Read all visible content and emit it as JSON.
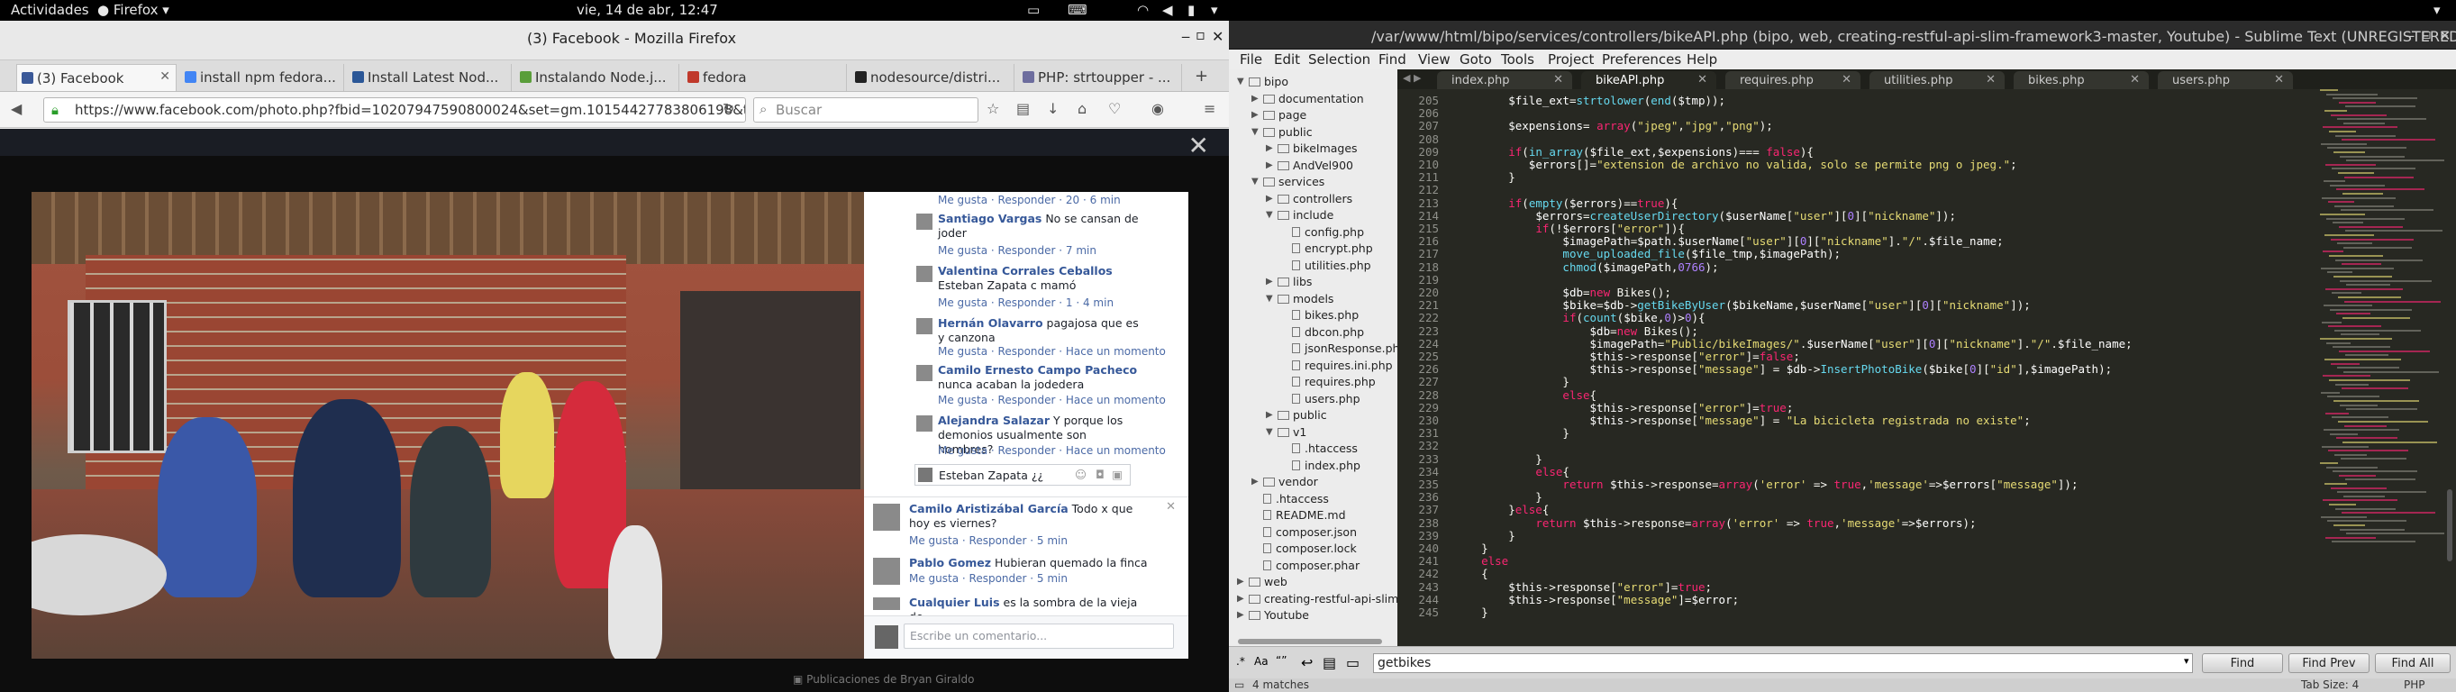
{
  "topbar": {
    "activities": "Actividades",
    "app": "Firefox",
    "clock": "vie, 14 de abr, 12:47"
  },
  "firefox": {
    "title": "(3) Facebook - Mozilla Firefox",
    "tabs": [
      {
        "label": "(3) Facebook",
        "color": "#3b5998"
      },
      {
        "label": "install npm fedora...",
        "color": "#4285f4"
      },
      {
        "label": "Install Latest Nod...",
        "color": "#2b5797"
      },
      {
        "label": "Instalando Node.j...",
        "color": "#5a9e3a"
      },
      {
        "label": "fedora",
        "color": "#c0392b"
      },
      {
        "label": "nodesource/distri...",
        "color": "#222222"
      },
      {
        "label": "PHP: strtoupper - ...",
        "color": "#6d6d9e"
      }
    ],
    "url": "https://www.facebook.com/photo.php?fbid=10207947590800024&set=gm.1015442778380​6198&type=3&",
    "search_placeholder": "Buscar"
  },
  "facebook": {
    "comments": [
      {
        "name": "",
        "text": "",
        "meta": "Me gusta · Responder · 20 · 6 min"
      },
      {
        "name": "Santiago Vargas",
        "text": "No se cansan de joder",
        "meta": "Me gusta · Responder · 7 min"
      },
      {
        "name": "Valentina Corrales Ceballos",
        "text": "Esteban Zapata c mamó",
        "meta": "Me gusta · Responder · 1 · 4 min"
      },
      {
        "name": "Hernán Olavarro",
        "text": "pagajosa que es y canzona",
        "meta": "Me gusta · Responder · Hace un momento"
      },
      {
        "name": "Camilo Ernesto Campo Pacheco",
        "text": "nunca acaban la jodedera",
        "meta": "Me gusta · Responder · Hace un momento"
      },
      {
        "name": "Alejandra Salazar",
        "text": "Y porque los demonios usualmente son hombres?",
        "meta": "Me gusta · Responder · Hace un momento"
      }
    ],
    "reply_input": "Esteban Zapata ¿¿",
    "comments2": [
      {
        "name": "Camilo Aristizábal García",
        "text": "Todo x que hoy es viernes?",
        "meta": "Me gusta · Responder · 5 min"
      },
      {
        "name": "Pablo Gomez",
        "text": "Hubieran quemado la finca",
        "meta": "Me gusta · Responder · 5 min"
      },
      {
        "name": "Cualquier Luis",
        "text": "es la sombra de la vieja de",
        "meta": ""
      }
    ],
    "comment_placeholder": "Escribe un comentario...",
    "bg_label": "Publicaciones de Bryan Giraldo"
  },
  "sublime": {
    "title": "/var/www/html/bipo/services/controllers/bikeAPI.php (bipo, web, creating-restful-api-slim-framework3-master, Youtube) - Sublime Text (UNREGISTERED)",
    "menu": [
      "File",
      "Edit",
      "Selection",
      "Find",
      "View",
      "Goto",
      "Tools",
      "Project",
      "Preferences",
      "Help"
    ],
    "tabs": [
      "index.php",
      "bikeAPI.php",
      "requires.php",
      "utilities.php",
      "bikes.php",
      "users.php"
    ],
    "active_tab": 1,
    "tree": [
      {
        "d": 0,
        "t": "folder",
        "open": true,
        "label": "bipo"
      },
      {
        "d": 1,
        "t": "folder",
        "open": false,
        "label": "documentation"
      },
      {
        "d": 1,
        "t": "folder",
        "open": false,
        "label": "page"
      },
      {
        "d": 1,
        "t": "folder",
        "open": true,
        "label": "public"
      },
      {
        "d": 2,
        "t": "folder",
        "open": false,
        "label": "bikeImages"
      },
      {
        "d": 2,
        "t": "folder",
        "open": false,
        "label": "AndVel900"
      },
      {
        "d": 1,
        "t": "folder",
        "open": true,
        "label": "services"
      },
      {
        "d": 2,
        "t": "folder",
        "open": false,
        "label": "controllers"
      },
      {
        "d": 2,
        "t": "folder",
        "open": true,
        "label": "include"
      },
      {
        "d": 3,
        "t": "file",
        "label": "config.php"
      },
      {
        "d": 3,
        "t": "file",
        "label": "encrypt.php"
      },
      {
        "d": 3,
        "t": "file",
        "label": "utilities.php"
      },
      {
        "d": 2,
        "t": "folder",
        "open": false,
        "label": "libs"
      },
      {
        "d": 2,
        "t": "folder",
        "open": true,
        "label": "models"
      },
      {
        "d": 3,
        "t": "file",
        "label": "bikes.php"
      },
      {
        "d": 3,
        "t": "file",
        "label": "dbcon.php"
      },
      {
        "d": 3,
        "t": "file",
        "label": "jsonResponse.php"
      },
      {
        "d": 3,
        "t": "file",
        "label": "requires.ini.php"
      },
      {
        "d": 3,
        "t": "file",
        "label": "requires.php"
      },
      {
        "d": 3,
        "t": "file",
        "label": "users.php"
      },
      {
        "d": 2,
        "t": "folder",
        "open": false,
        "label": "public"
      },
      {
        "d": 2,
        "t": "folder",
        "open": true,
        "label": "v1"
      },
      {
        "d": 3,
        "t": "file",
        "label": ".htaccess"
      },
      {
        "d": 3,
        "t": "file",
        "label": "index.php"
      },
      {
        "d": 1,
        "t": "folder",
        "open": false,
        "label": "vendor"
      },
      {
        "d": 1,
        "t": "file",
        "label": ".htaccess"
      },
      {
        "d": 1,
        "t": "file",
        "label": "README.md"
      },
      {
        "d": 1,
        "t": "file",
        "label": "composer.json"
      },
      {
        "d": 1,
        "t": "file",
        "label": "composer.lock"
      },
      {
        "d": 1,
        "t": "file",
        "label": "composer.phar"
      },
      {
        "d": 0,
        "t": "folder",
        "open": false,
        "label": "web"
      },
      {
        "d": 0,
        "t": "folder",
        "open": false,
        "label": "creating-restful-api-slim-fr"
      },
      {
        "d": 0,
        "t": "folder",
        "open": false,
        "label": "Youtube"
      }
    ],
    "code": [
      {
        "n": "205",
        "s": "        $file_ext=strtolower(end($tmp));"
      },
      {
        "n": "206",
        "s": ""
      },
      {
        "n": "207",
        "s": "        $expensions= array(\"jpeg\",\"jpg\",\"png\");"
      },
      {
        "n": "208",
        "s": ""
      },
      {
        "n": "209",
        "s": "        if(in_array($file_ext,$expensions)=== false){"
      },
      {
        "n": "210",
        "s": "           $errors[]=\"extension de archivo no valida, solo se permite png o jpeg.\";"
      },
      {
        "n": "211",
        "s": "        }"
      },
      {
        "n": "212",
        "s": ""
      },
      {
        "n": "213",
        "s": "        if(empty($errors)==true){"
      },
      {
        "n": "214",
        "s": "            $errors=createUserDirectory($userName[\"user\"][0][\"nickname\"]);"
      },
      {
        "n": "215",
        "s": "            if(!$errors[\"error\"]){"
      },
      {
        "n": "216",
        "s": "                $imagePath=$path.$userName[\"user\"][0][\"nickname\"].\"/\".$file_name;"
      },
      {
        "n": "217",
        "s": "                move_uploaded_file($file_tmp,$imagePath);"
      },
      {
        "n": "218",
        "s": "                chmod($imagePath,0766);"
      },
      {
        "n": "219",
        "s": ""
      },
      {
        "n": "220",
        "s": "                $db=new Bikes();"
      },
      {
        "n": "221",
        "s": "                $bike=$db->getBikeByUser($bikeName,$userName[\"user\"][0][\"nickname\"]);"
      },
      {
        "n": "222",
        "s": "                if(count($bike,0)>0){"
      },
      {
        "n": "223",
        "s": "                    $db=new Bikes();"
      },
      {
        "n": "224",
        "s": "                    $imagePath=\"Public/bikeImages/\".$userName[\"user\"][0][\"nickname\"].\"/\".$file_name;"
      },
      {
        "n": "225",
        "s": "                    $this->response[\"error\"]=false;"
      },
      {
        "n": "226",
        "s": "                    $this->response[\"message\"] = $db->InsertPhotoBike($bike[0][\"id\"],$imagePath);"
      },
      {
        "n": "227",
        "s": "                }"
      },
      {
        "n": "228",
        "s": "                else{"
      },
      {
        "n": "229",
        "s": "                    $this->response[\"error\"]=true;"
      },
      {
        "n": "230",
        "s": "                    $this->response[\"message\"] = \"La bicicleta registrada no existe\";"
      },
      {
        "n": "231",
        "s": "                }"
      },
      {
        "n": "232",
        "s": ""
      },
      {
        "n": "233",
        "s": "            }"
      },
      {
        "n": "234",
        "s": "            else{"
      },
      {
        "n": "235",
        "s": "                return $this->response=array('error' => true,'message'=>$errors[\"message\"]);"
      },
      {
        "n": "236",
        "s": "            }"
      },
      {
        "n": "237",
        "s": "        }else{"
      },
      {
        "n": "238",
        "s": "            return $this->response=array('error' => true,'message'=>$errors);"
      },
      {
        "n": "239",
        "s": "        }"
      },
      {
        "n": "240",
        "s": "    }"
      },
      {
        "n": "241",
        "s": "    else"
      },
      {
        "n": "242",
        "s": "    {"
      },
      {
        "n": "243",
        "s": "        $this->response[\"error\"]=true;"
      },
      {
        "n": "244",
        "s": "        $this->response[\"message\"]=$error;"
      },
      {
        "n": "245",
        "s": "    }"
      }
    ],
    "find_value": "getbikes",
    "find_buttons": {
      "find": "Find",
      "prev": "Find Prev",
      "all": "Find All"
    },
    "status_left": "4 matches",
    "status_tab": "Tab Size: 4",
    "status_lang": "PHP"
  }
}
